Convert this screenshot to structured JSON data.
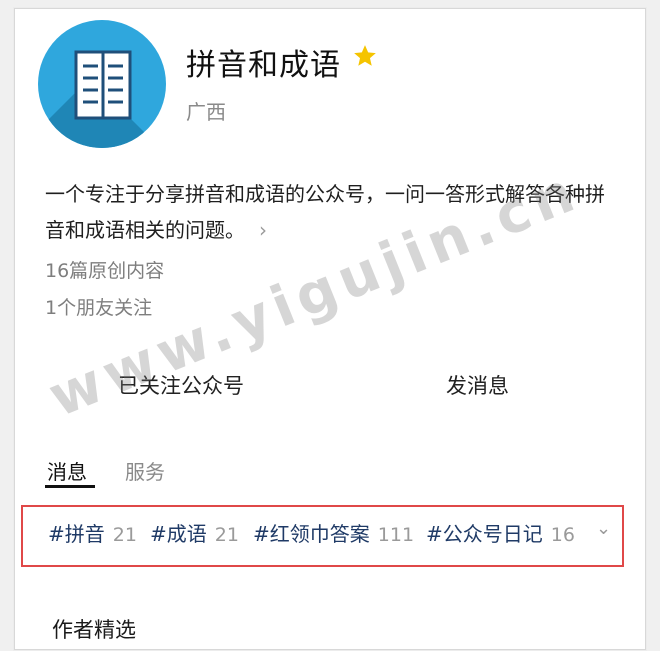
{
  "profile": {
    "name": "拼音和成语",
    "region": "广西",
    "description": "一个专注于分享拼音和成语的公众号，一问一答形式解答各种拼音和成语相关的问题。",
    "original_count": "16篇原创内容",
    "friends": "1个朋友关注",
    "star_color": "#f5c400"
  },
  "actions": {
    "follow_label": "已关注公众号",
    "message_label": "发消息"
  },
  "tabs": {
    "messages": "消息",
    "services": "服务"
  },
  "tags": [
    {
      "label": "#拼音",
      "count": "21"
    },
    {
      "label": "#成语",
      "count": "21"
    },
    {
      "label": "#红领巾答案",
      "count": "111"
    },
    {
      "label": "#公众号日记",
      "count": "16"
    }
  ],
  "section": {
    "title": "作者精选"
  },
  "watermark": "www.yigujin.cn",
  "icons": {
    "avatar": "book-icon",
    "star": "star-icon",
    "more": "chevron-right-icon",
    "expand": "chevron-down-icon"
  },
  "colors": {
    "avatar_bg": "#2fa7dd",
    "highlight_border": "#e04848",
    "tag_text": "#1f3a66"
  }
}
